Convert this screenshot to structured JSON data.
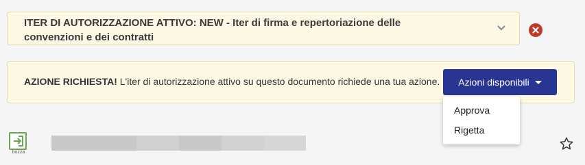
{
  "iter_panel": {
    "title": "ITER DI AUTORIZZAZIONE ATTIVO: NEW - Iter di firma e repertoriazione delle convenzioni e dei contratti"
  },
  "action_panel": {
    "bold_text": "AZIONE RICHIESTA!",
    "text": " L'iter di autorizzazione attivo su questo documento richiede una tua azione.",
    "button_label": "Azioni disponibili"
  },
  "dropdown": {
    "items": [
      "Approva",
      "Rigetta"
    ]
  },
  "document": {
    "icon_label": "bozza"
  },
  "colors": {
    "panel_bg": "#fcf8e3",
    "primary": "#283593",
    "danger": "#c0392b",
    "doc_icon": "#6aa84f"
  },
  "icons": [
    "chevron-down-icon",
    "close-icon",
    "caret-down-icon",
    "draft-document-icon",
    "star-icon"
  ]
}
